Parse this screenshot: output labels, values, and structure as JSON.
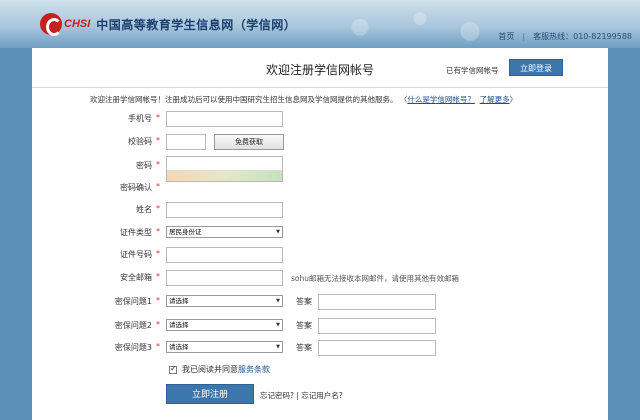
{
  "topbar": {
    "logo_latin": "CHSI",
    "logo_cn": "中国高等教育学生信息网（学信网）",
    "home": "首页",
    "sep": "|",
    "hotline": "客服热线：010-82199588"
  },
  "header": {
    "title": "欢迎注册学信网帐号",
    "has_account": "已有学信网帐号",
    "login_label": "立即登录"
  },
  "intro": {
    "text": "欢迎注册学信网帐号！注册成功后可以使用中国研究生招生信息网及学信网提供的其他服务。",
    "link_open": "〈",
    "what_link": "什么是学信网帐号？",
    "more_link": "了解更多",
    "link_close": "〉"
  },
  "form": {
    "required_mark": "*",
    "phone_label": "手机号",
    "code_label": "校验码",
    "sms_button": "免费获取",
    "password_label": "密码",
    "confirm_label": "密码确认",
    "name_label": "姓名",
    "idtype_label": "证件类型",
    "idtype_value": "居民身份证",
    "idnum_label": "证件号码",
    "email_label": "安全邮箱",
    "email_hint": "sohu邮箱无法接收本网邮件，请使用其他有效邮箱",
    "q1_label": "密保问题1",
    "q2_label": "密保问题2",
    "q3_label": "密保问题3",
    "select_placeholder": "请选择",
    "answer_label": "答案"
  },
  "footer": {
    "agree_text": "我已阅读并同意",
    "terms_link": "服务条款",
    "register_label": "立即注册",
    "forgot_password": "忘记密码?",
    "forgot_sep": " | ",
    "forgot_username": "忘记用户名?"
  }
}
